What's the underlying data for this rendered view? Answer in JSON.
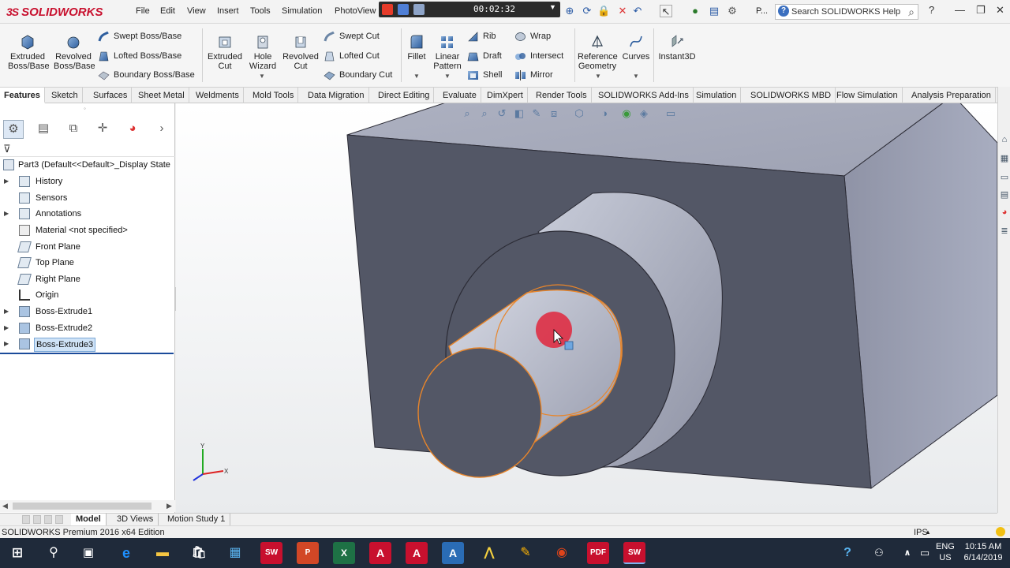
{
  "app": {
    "logo_text": "SOLIDWORKS",
    "menu": [
      "File",
      "Edit",
      "View",
      "Insert",
      "Tools",
      "Simulation",
      "PhotoView"
    ],
    "recorder_time": "00:02:32",
    "tab_label": "P...",
    "search_placeholder": "Search SOLIDWORKS Help",
    "help_icon": "?"
  },
  "ribbon": {
    "big_buttons": [
      {
        "label1": "Extruded",
        "label2": "Boss/Base",
        "icon": "extrude-icon"
      },
      {
        "label1": "Revolved",
        "label2": "Boss/Base",
        "icon": "revolve-icon"
      },
      {
        "label1": "Extruded",
        "label2": "Cut",
        "icon": "extrude-cut-icon"
      },
      {
        "label1": "Hole",
        "label2": "Wizard",
        "icon": "hole-wizard-icon"
      },
      {
        "label1": "Revolved",
        "label2": "Cut",
        "icon": "revolve-cut-icon"
      },
      {
        "label1": "Fillet",
        "label2": "",
        "icon": "fillet-icon"
      },
      {
        "label1": "Linear",
        "label2": "Pattern",
        "icon": "linear-pattern-icon"
      },
      {
        "label1": "Reference",
        "label2": "Geometry",
        "icon": "reference-geometry-icon"
      },
      {
        "label1": "Curves",
        "label2": "",
        "icon": "curves-icon"
      },
      {
        "label1": "Instant3D",
        "label2": "",
        "icon": "instant3d-icon"
      }
    ],
    "small_buttons": {
      "swept_boss": "Swept Boss/Base",
      "lofted_boss": "Lofted Boss/Base",
      "boundary_boss": "Boundary Boss/Base",
      "swept_cut": "Swept Cut",
      "lofted_cut": "Lofted Cut",
      "boundary_cut": "Boundary Cut",
      "rib": "Rib",
      "draft": "Draft",
      "shell": "Shell",
      "wrap": "Wrap",
      "intersect": "Intersect",
      "mirror": "Mirror"
    }
  },
  "tabs": [
    "Features",
    "Sketch",
    "Surfaces",
    "Sheet Metal",
    "Weldments",
    "Mold Tools",
    "Data Migration",
    "Direct Editing",
    "Evaluate",
    "DimXpert",
    "Render Tools",
    "SOLIDWORKS Add-Ins",
    "Simulation",
    "SOLIDWORKS MBD",
    "Flow Simulation",
    "Analysis Preparation"
  ],
  "feature_tree": {
    "root": "Part3  (Default<<Default>_Display State",
    "items": [
      {
        "label": "History",
        "expandable": true
      },
      {
        "label": "Sensors",
        "expandable": false
      },
      {
        "label": "Annotations",
        "expandable": true
      },
      {
        "label": "Material <not specified>",
        "expandable": false
      },
      {
        "label": "Front Plane",
        "expandable": false
      },
      {
        "label": "Top Plane",
        "expandable": false
      },
      {
        "label": "Right Plane",
        "expandable": false
      },
      {
        "label": "Origin",
        "expandable": false
      },
      {
        "label": "Boss-Extrude1",
        "expandable": true
      },
      {
        "label": "Boss-Extrude2",
        "expandable": true
      },
      {
        "label": "Boss-Extrude3",
        "expandable": true,
        "selected": true
      }
    ]
  },
  "triad": {
    "y": "Y",
    "x": "X"
  },
  "bottom_tabs": [
    "Model",
    "3D Views",
    "Motion Study 1"
  ],
  "status": {
    "edition": "SOLIDWORKS Premium 2016 x64 Edition",
    "units": "IPS"
  },
  "taskbar": {
    "lang1": "ENG",
    "lang2": "US",
    "time": "10:15 AM",
    "date": "6/14/2019"
  },
  "colors": {
    "accent": "#1b4b9a",
    "selection": "#e8852a",
    "model_face": "#535766",
    "cursor_highlight": "#e0263c"
  }
}
